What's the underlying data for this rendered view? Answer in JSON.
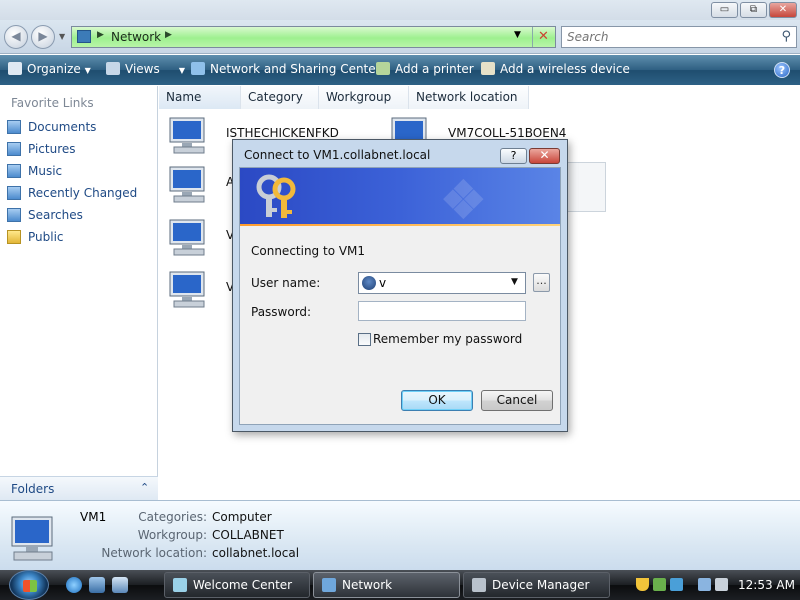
{
  "window": {
    "minimize_glyph": "▭",
    "maximize_glyph": "⧉",
    "close_glyph": "✕"
  },
  "address_bar": {
    "crumb": "Network",
    "search_placeholder": "Search"
  },
  "command_bar": {
    "organize": "Organize",
    "views": "Views",
    "network_sharing": "Network and Sharing Center",
    "add_printer": "Add a printer",
    "add_wireless": "Add a wireless device",
    "help": "?"
  },
  "nav": {
    "header": "Favorite Links",
    "items": [
      {
        "label": "Documents",
        "icon": "documents-icon"
      },
      {
        "label": "Pictures",
        "icon": "pictures-icon"
      },
      {
        "label": "Music",
        "icon": "music-icon"
      },
      {
        "label": "Recently Changed",
        "icon": "recently-changed-icon"
      },
      {
        "label": "Searches",
        "icon": "searches-icon"
      },
      {
        "label": "Public",
        "icon": "public-folder-icon"
      }
    ],
    "folders_label": "Folders"
  },
  "filelist": {
    "columns": [
      "Name",
      "Category",
      "Workgroup",
      "Network location"
    ],
    "items": [
      {
        "label": "ISTHECHICKENFKD"
      },
      {
        "label": "VM7COLL-51BOEN4"
      },
      {
        "label": "AD"
      },
      {
        "label": "VM"
      },
      {
        "label": "VM"
      }
    ]
  },
  "details": {
    "name": "VM1",
    "fields": [
      {
        "label": "Categories:",
        "value": "Computer"
      },
      {
        "label": "Workgroup:",
        "value": "COLLABNET"
      },
      {
        "label": "Network location:",
        "value": "collabnet.local"
      }
    ]
  },
  "dialog": {
    "title": "Connect to VM1.collabnet.local",
    "help_glyph": "?",
    "close_glyph": "✕",
    "message": "Connecting to VM1",
    "username_label": "User name:",
    "username_value": "v",
    "browse_label": "...",
    "password_label": "Password:",
    "password_value": "",
    "remember_label": "Remember my password",
    "remember_checked": false,
    "ok_label": "OK",
    "cancel_label": "Cancel"
  },
  "taskbar": {
    "tasks": [
      "Welcome Center",
      "Network",
      "Device Manager"
    ],
    "clock": "12:53 AM"
  },
  "colors": {
    "address_bar_green": "#9ef08f",
    "command_bar": "#2e5f82",
    "link_blue": "#1f4a85",
    "dialog_banner": "#2b49c4"
  }
}
